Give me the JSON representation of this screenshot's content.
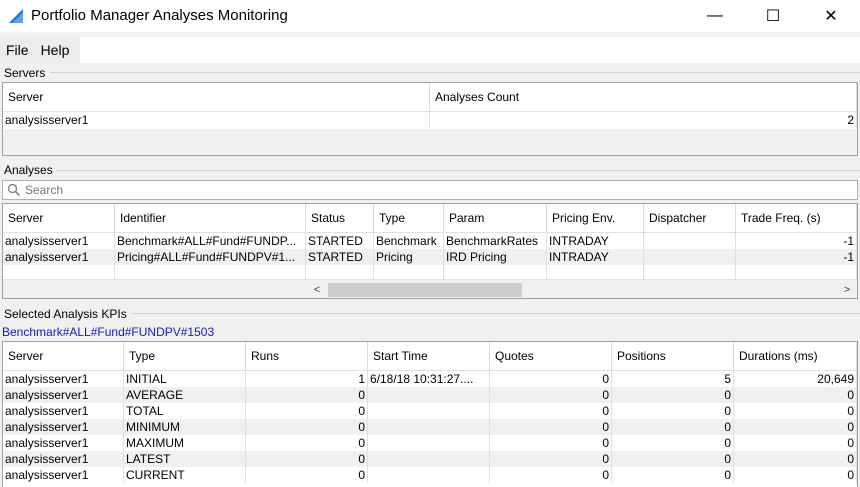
{
  "window": {
    "title": "Portfolio Manager Analyses Monitoring",
    "min_glyph": "—",
    "max_glyph": "☐",
    "close_glyph": "✕",
    "icon": "app-triangle-icon",
    "accent": "#1e6fc8"
  },
  "menu": {
    "file": "File",
    "help": "Help"
  },
  "servers": {
    "label": "Servers",
    "columns": [
      "Server",
      "Analyses Count"
    ],
    "rows": [
      {
        "server": "analysisserver1",
        "count": "2"
      }
    ]
  },
  "analyses": {
    "label": "Analyses",
    "search_placeholder": "Search",
    "columns": [
      "Server",
      "Identifier",
      "Status",
      "Type",
      "Param",
      "Pricing Env.",
      "Dispatcher",
      "Trade Freq. (s)"
    ],
    "rows": [
      {
        "server": "analysisserver1",
        "identifier": "Benchmark#ALL#Fund#FUNDP...",
        "status": "STARTED",
        "type": "Benchmark",
        "param": "BenchmarkRates",
        "pricing": "INTRADAY",
        "dispatcher": "",
        "freq": "-1"
      },
      {
        "server": "analysisserver1",
        "identifier": "Pricing#ALL#Fund#FUNDPV#1...",
        "status": "STARTED",
        "type": "Pricing",
        "param": "IRD Pricing",
        "pricing": "INTRADAY",
        "dispatcher": "",
        "freq": "-1"
      }
    ],
    "scroll_left": "<",
    "scroll_right": ">"
  },
  "kpis": {
    "label": "Selected Analysis KPIs",
    "selected": "Benchmark#ALL#Fund#FUNDPV#1503",
    "columns": [
      "Server",
      "Type",
      "Runs",
      "Start Time",
      "Quotes",
      "Positions",
      "Durations (ms)"
    ],
    "rows": [
      {
        "server": "analysisserver1",
        "type": "INITIAL",
        "runs": "1",
        "start": "6/18/18 10:31:27....",
        "quotes": "0",
        "positions": "5",
        "durations": "20,649"
      },
      {
        "server": "analysisserver1",
        "type": "AVERAGE",
        "runs": "0",
        "start": "",
        "quotes": "0",
        "positions": "0",
        "durations": "0"
      },
      {
        "server": "analysisserver1",
        "type": "TOTAL",
        "runs": "0",
        "start": "",
        "quotes": "0",
        "positions": "0",
        "durations": "0"
      },
      {
        "server": "analysisserver1",
        "type": "MINIMUM",
        "runs": "0",
        "start": "",
        "quotes": "0",
        "positions": "0",
        "durations": "0"
      },
      {
        "server": "analysisserver1",
        "type": "MAXIMUM",
        "runs": "0",
        "start": "",
        "quotes": "0",
        "positions": "0",
        "durations": "0"
      },
      {
        "server": "analysisserver1",
        "type": "LATEST",
        "runs": "0",
        "start": "",
        "quotes": "0",
        "positions": "0",
        "durations": "0"
      },
      {
        "server": "analysisserver1",
        "type": "CURRENT",
        "runs": "0",
        "start": "",
        "quotes": "0",
        "positions": "0",
        "durations": "0"
      }
    ]
  }
}
